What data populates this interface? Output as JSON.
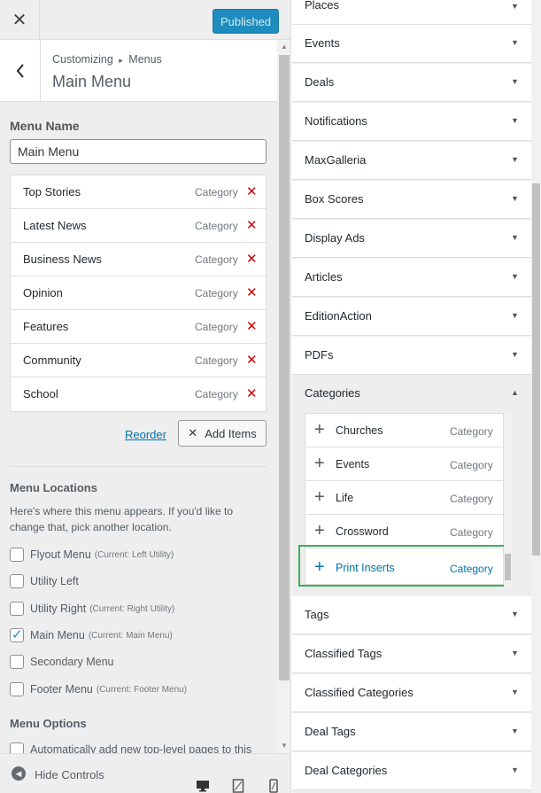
{
  "topbar": {
    "close_icon": "close-icon",
    "publish_label": "Published"
  },
  "header": {
    "breadcrumb_root": "Customizing",
    "breadcrumb_sep": "▸",
    "breadcrumb_section": "Menus",
    "title": "Main Menu"
  },
  "menu_name": {
    "label": "Menu Name",
    "value": "Main Menu"
  },
  "menu_items": [
    {
      "label": "Top Stories",
      "type": "Category"
    },
    {
      "label": "Latest News",
      "type": "Category"
    },
    {
      "label": "Business News",
      "type": "Category"
    },
    {
      "label": "Opinion",
      "type": "Category"
    },
    {
      "label": "Features",
      "type": "Category"
    },
    {
      "label": "Community",
      "type": "Category"
    },
    {
      "label": "School",
      "type": "Category"
    }
  ],
  "actions": {
    "reorder_label": "Reorder",
    "add_items_label": "Add Items"
  },
  "locations": {
    "title": "Menu Locations",
    "description": "Here's where this menu appears. If you'd like to change that, pick another location.",
    "items": [
      {
        "label": "Flyout Menu",
        "current": "(Current: Left Utility)",
        "checked": false
      },
      {
        "label": "Utility Left",
        "current": "",
        "checked": false
      },
      {
        "label": "Utility Right",
        "current": "(Current: Right Utility)",
        "checked": false
      },
      {
        "label": "Main Menu",
        "current": "(Current: Main Menu)",
        "checked": true
      },
      {
        "label": "Secondary Menu",
        "current": "",
        "checked": false
      },
      {
        "label": "Footer Menu",
        "current": "(Current: Footer Menu)",
        "checked": false
      }
    ]
  },
  "options": {
    "title": "Menu Options",
    "auto_add_label": "Automatically add new top-level pages to this"
  },
  "footer": {
    "hide_label": "Hide Controls"
  },
  "right_panel": {
    "accordion_top": [
      "Places",
      "Events",
      "Deals",
      "Notifications",
      "MaxGalleria",
      "Box Scores",
      "Display Ads",
      "Articles",
      "EditionAction",
      "PDFs"
    ],
    "categories_title": "Categories",
    "categories": [
      {
        "label": "Churches",
        "type": "Category"
      },
      {
        "label": "Events",
        "type": "Category"
      },
      {
        "label": "Life",
        "type": "Category"
      },
      {
        "label": "Crossword",
        "type": "Category"
      },
      {
        "label": "Print Inserts",
        "type": "Category"
      }
    ],
    "accordion_bottom": [
      "Tags",
      "Classified Tags",
      "Classified Categories",
      "Deal Tags",
      "Deal Categories"
    ]
  }
}
